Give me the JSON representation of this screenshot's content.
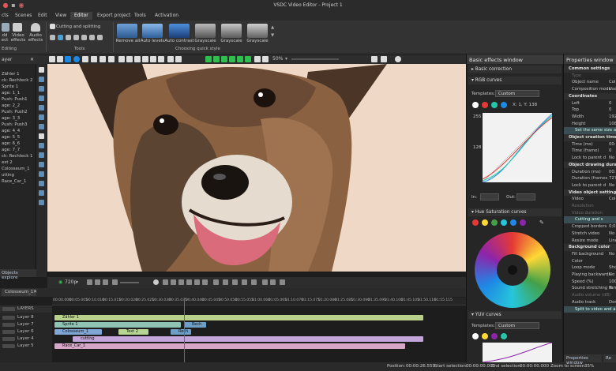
{
  "window": {
    "title": "VSDC Video Editor - Project 1"
  },
  "menu": [
    "cts",
    "Scenes",
    "Edit",
    "View",
    "Editor",
    "Export project",
    "Tools",
    "Activation"
  ],
  "ribbon": {
    "add_label": "dd\nect",
    "video_effects": "Video\neffects",
    "audio_effects": "Audio\neffects",
    "editing_label": "Editing",
    "cutting": "Cutting and splitting",
    "tools_label": "Tools",
    "quick_style_label": "Choosing quick style",
    "styles": [
      "Remove all",
      "Auto levels",
      "Auto contrast",
      "Grayscale",
      "Grayscale",
      "Grayscale"
    ]
  },
  "toolbar": {
    "zoom": "50%"
  },
  "left_panel": {
    "title": "ayer",
    "items": [
      "Zähler 1",
      "ck: Rechteck 2",
      "Sprite 1",
      "age: 1_1",
      "Push: Push1",
      "age: 2_2",
      "Push: Push2",
      "age: 3_3",
      "Push: Push3",
      "age: 4_4",
      "age: 5_5",
      "age: 6_6",
      "age: 7_7",
      "ck: Rechteck 1",
      "ext 2",
      "Colosseum_1",
      "utting",
      "Race_Car_1"
    ],
    "tab": "Objects explore"
  },
  "player": {
    "quality": "720p"
  },
  "timeline": {
    "tab": "Colosseum_1",
    "ruler": [
      "00:00.000",
      "00:05.005",
      "00:10.010",
      "00:15.015",
      "00:20.020",
      "00:25.025",
      "00:30.030",
      "00:35.035",
      "00:40.040",
      "00:45.045",
      "00:50.050",
      "00:55.055",
      "01:00.060",
      "01:05.065",
      "01:10.070",
      "01:15.075",
      "01:20.080",
      "01:25.085",
      "01:30.090",
      "01:35.095",
      "01:40.100",
      "01:45.105",
      "01:50.110",
      "01:55.115",
      "02:00.120"
    ],
    "tracks": [
      "LAYERS",
      "Layer 8",
      "Layer 7",
      "Layer 6",
      "Layer 4",
      "Layer 5"
    ],
    "clips": [
      "Zähler 1",
      "Sprite 1",
      "Rech",
      "Colosseum_1",
      "Text 2",
      "Rech",
      "cutting",
      "Race_Car_1"
    ]
  },
  "effects_panel": {
    "title": "Basic effects window",
    "basic_correction": "Basic correction",
    "rgb_curves": "RGB curves",
    "templates_label": "Templates:",
    "templates_value": "Custom",
    "curve_info": "X: 1, Y: 138",
    "y_labels": [
      "255",
      "128"
    ],
    "in_label": "In:",
    "out_label": "Out:",
    "hue_saturation": "Hue Saturation curves",
    "yuv_curves": "YUV curves",
    "templates_value2": "Custom"
  },
  "properties": {
    "title": "Properties window",
    "rows": [
      {
        "k": "Common settings",
        "type": "sec"
      },
      {
        "k": "Type",
        "v": "",
        "type": "dim"
      },
      {
        "k": "Object name",
        "v": "Col"
      },
      {
        "k": "Composition mode",
        "v": "Use"
      },
      {
        "k": "Coordinates",
        "type": "sec"
      },
      {
        "k": "Left",
        "v": "0"
      },
      {
        "k": "Top",
        "v": "0"
      },
      {
        "k": "Width",
        "v": "192"
      },
      {
        "k": "Height",
        "v": "108"
      },
      {
        "k": "Set the same size as t",
        "type": "btn"
      },
      {
        "k": "Object creation time",
        "type": "sec"
      },
      {
        "k": "Time (ms)",
        "v": "00:"
      },
      {
        "k": "Time (frame)",
        "v": "0"
      },
      {
        "k": "Lock to parent d",
        "v": "No"
      },
      {
        "k": "Object drawing duration",
        "type": "sec"
      },
      {
        "k": "Duration (ms)",
        "v": "00:"
      },
      {
        "k": "Duration (frames",
        "v": "727"
      },
      {
        "k": "Lock to parent d",
        "v": "No"
      },
      {
        "k": "Video object settings",
        "type": "sec"
      },
      {
        "k": "Video",
        "v": "Col"
      },
      {
        "k": "Resolution",
        "v": "",
        "type": "dim"
      },
      {
        "k": "Video duration",
        "v": "",
        "type": "dim"
      },
      {
        "k": "Cutting and s",
        "type": "btn"
      },
      {
        "k": "Cropped borders",
        "v": "0;0"
      },
      {
        "k": "Stretch video",
        "v": "No"
      },
      {
        "k": "Resize mode",
        "v": "Line"
      },
      {
        "k": "Background color",
        "type": "sec"
      },
      {
        "k": "Fill background",
        "v": "No"
      },
      {
        "k": "Color",
        "v": ""
      },
      {
        "k": "Loop mode",
        "v": "Sho"
      },
      {
        "k": "Playing backwards",
        "v": "No"
      },
      {
        "k": "Speed (%)",
        "v": "100"
      },
      {
        "k": "Sound stretching m",
        "v": "Tem"
      },
      {
        "k": "Audio volume (dB)",
        "v": "",
        "type": "dim"
      },
      {
        "k": "Audio track",
        "v": "Don"
      },
      {
        "k": "Split to video and a",
        "type": "btn"
      }
    ],
    "bottom_tab": "Properties window",
    "bottom_tab2": "Re"
  },
  "status": {
    "position_label": "Position:",
    "position": "00:00:26.559",
    "start_label": "Start selection:",
    "start": "00:00:00.000",
    "end_label": "End selection:",
    "end": "00:00:00.000",
    "zoom_label": "Zoom to screen:",
    "zoom": "35%"
  }
}
